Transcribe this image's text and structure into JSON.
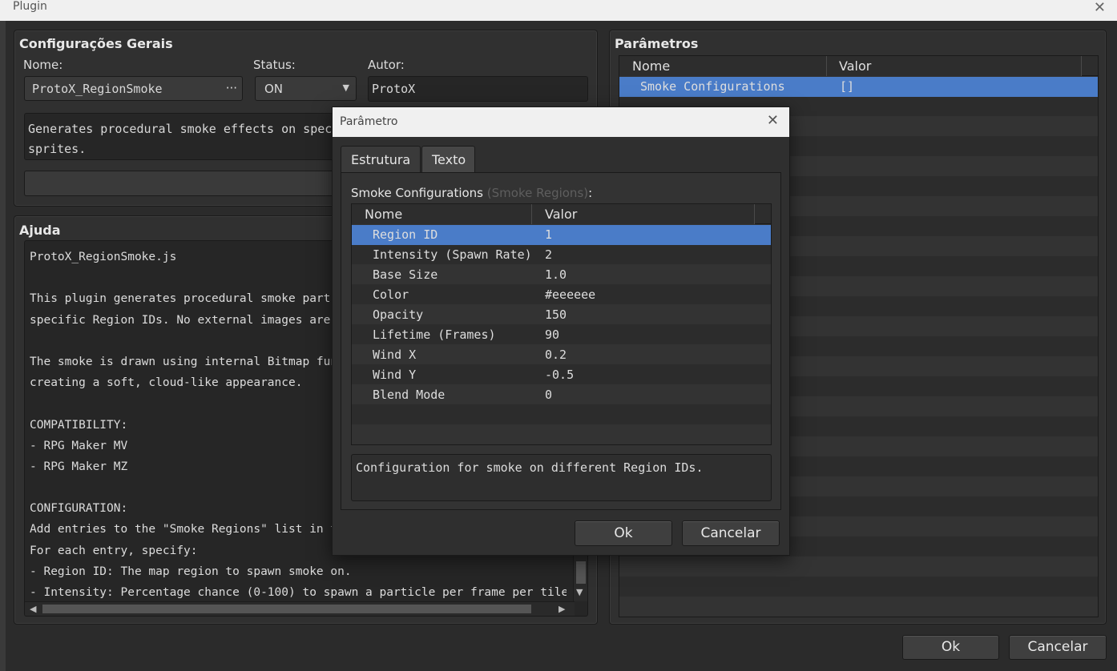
{
  "window": {
    "title": "Plugin"
  },
  "general": {
    "title": "Configurações Gerais",
    "name_label": "Nome:",
    "name_value": "ProtoX_RegionSmoke",
    "name_more": "···",
    "status_label": "Status:",
    "status_value": "ON",
    "author_label": "Autor:",
    "author_value": "ProtoX",
    "description_line1": "Generates procedural smoke effects on specif",
    "description_line2": "sprites."
  },
  "help": {
    "title": "Ajuda",
    "lines": [
      "ProtoX_RegionSmoke.js",
      "",
      "This plugin generates procedural smoke part",
      "specific Region IDs. No external images are",
      "",
      "The smoke is drawn using internal Bitmap fun",
      "creating a soft, cloud-like appearance.",
      "",
      "COMPATIBILITY:",
      "- RPG Maker MV",
      "- RPG Maker MZ",
      "",
      "CONFIGURATION:",
      "Add entries to the \"Smoke Regions\" list in t",
      "For each entry, specify:",
      "- Region ID: The map region to spawn smoke on.",
      "- Intensity: Percentage chance (0-100) to spawn a particle per frame per tile"
    ]
  },
  "params": {
    "title": "Parâmetros",
    "col_name": "Nome",
    "col_value": "Valor",
    "row_name": "Smoke Configurations",
    "row_value": "[]"
  },
  "dialog": {
    "title": "Parâmetro",
    "tab_structure": "Estrutura",
    "tab_text": "Texto",
    "label": "Smoke Configurations",
    "label_sub": "(Smoke Regions)",
    "label_colon": ":",
    "col_name": "Nome",
    "col_value": "Valor",
    "rows": [
      {
        "name": "Region ID",
        "value": "1"
      },
      {
        "name": "Intensity (Spawn Rate)",
        "value": "2"
      },
      {
        "name": "Base Size",
        "value": "1.0"
      },
      {
        "name": "Color",
        "value": "#eeeeee"
      },
      {
        "name": "Opacity",
        "value": "150"
      },
      {
        "name": "Lifetime (Frames)",
        "value": "90"
      },
      {
        "name": "Wind X",
        "value": "0.2"
      },
      {
        "name": "Wind Y",
        "value": "-0.5"
      },
      {
        "name": "Blend Mode",
        "value": "0"
      }
    ],
    "description": "Configuration for smoke on different Region IDs.",
    "ok": "Ok",
    "cancel": "Cancelar"
  },
  "footer": {
    "ok": "Ok",
    "cancel": "Cancelar"
  },
  "colors": {
    "background": "#2b2b2b",
    "selection": "#4a7cc8",
    "panel": "#303030"
  }
}
